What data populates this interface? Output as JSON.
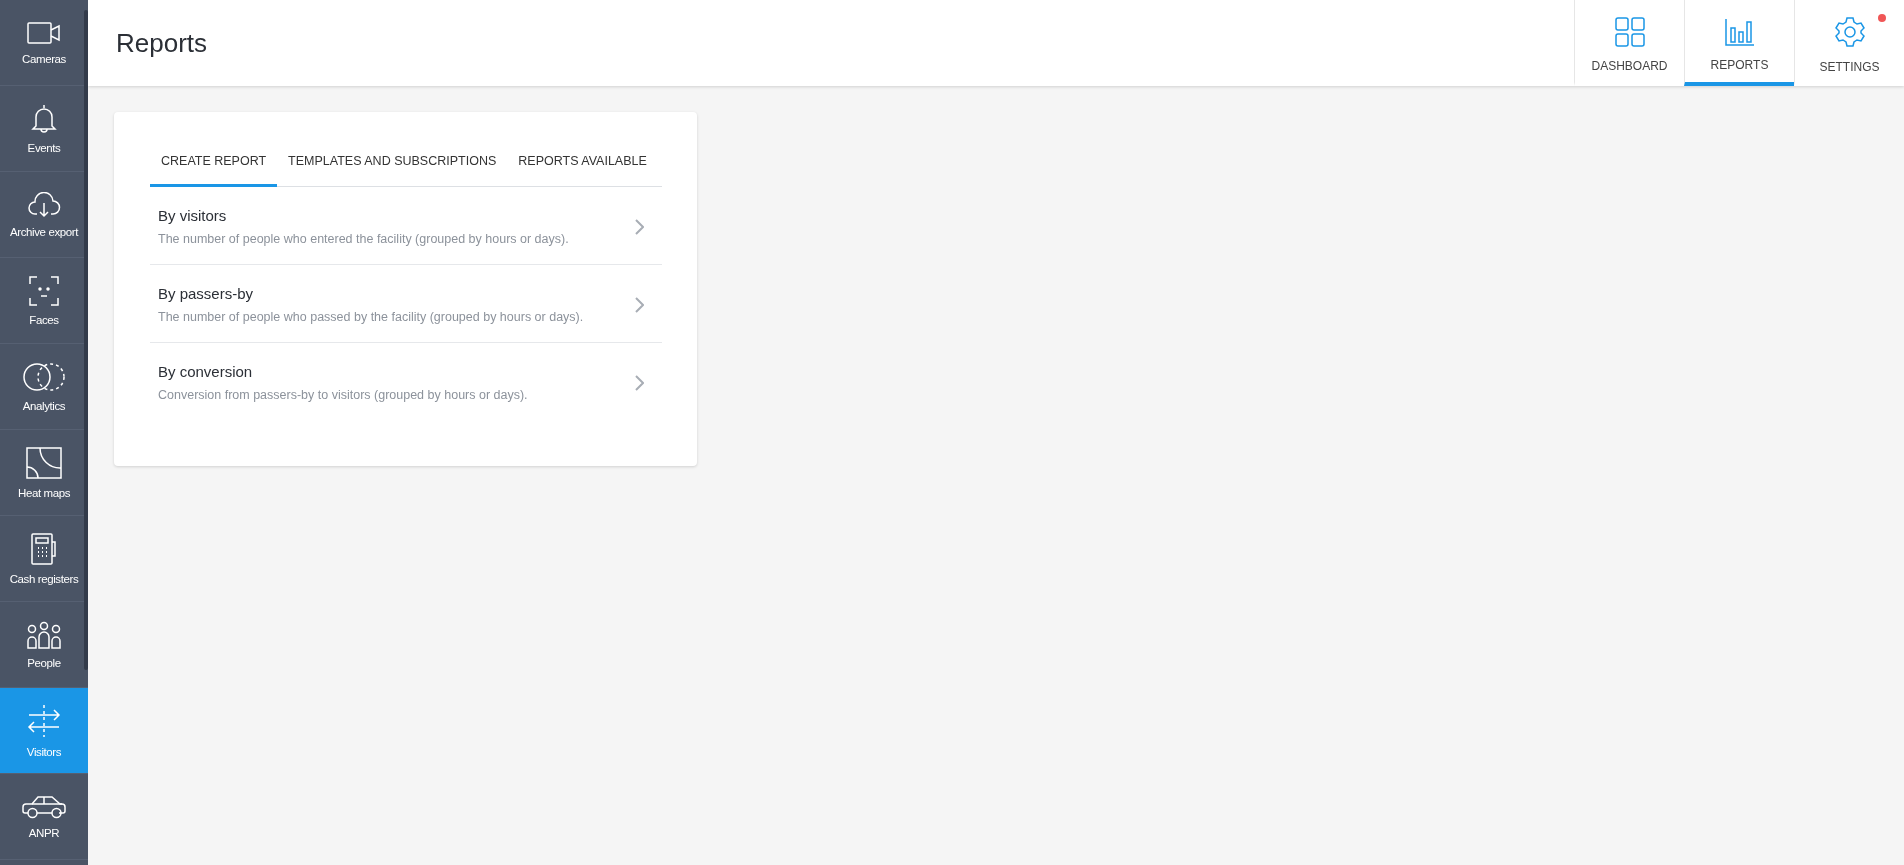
{
  "sidebar": {
    "items": [
      {
        "kind": "camera",
        "label": "Cameras",
        "selected": false
      },
      {
        "kind": "bell",
        "label": "Events",
        "selected": false
      },
      {
        "kind": "cloud",
        "label": "Archive export",
        "selected": false
      },
      {
        "kind": "face",
        "label": "Faces",
        "selected": false
      },
      {
        "kind": "circles",
        "label": "Analytics",
        "selected": false
      },
      {
        "kind": "heatmap",
        "label": "Heat maps",
        "selected": false
      },
      {
        "kind": "register",
        "label": "Cash registers",
        "selected": false
      },
      {
        "kind": "people",
        "label": "People",
        "selected": false
      },
      {
        "kind": "arrows",
        "label": "Visitors",
        "selected": true
      },
      {
        "kind": "car",
        "label": "ANPR",
        "selected": false
      }
    ]
  },
  "header": {
    "title": "Reports",
    "nav": [
      {
        "kind": "dashboard",
        "label": "DASHBOARD",
        "selected": false,
        "alert": false
      },
      {
        "kind": "reports",
        "label": "REPORTS",
        "selected": true,
        "alert": false
      },
      {
        "kind": "settings",
        "label": "SETTINGS",
        "selected": false,
        "alert": true
      }
    ]
  },
  "card": {
    "tabs": [
      {
        "label": "CREATE REPORT",
        "selected": true
      },
      {
        "label": "TEMPLATES AND SUBSCRIPTIONS",
        "selected": false
      },
      {
        "label": "REPORTS AVAILABLE",
        "selected": false
      }
    ],
    "reports": [
      {
        "title": "By visitors",
        "description": "The number of people who entered the facility (grouped by hours or days)."
      },
      {
        "title": "By passers-by",
        "description": "The number of people who passed by the facility (grouped by hours or days)."
      },
      {
        "title": "By conversion",
        "description": "Conversion from passers-by to visitors (grouped by hours or days)."
      }
    ]
  }
}
